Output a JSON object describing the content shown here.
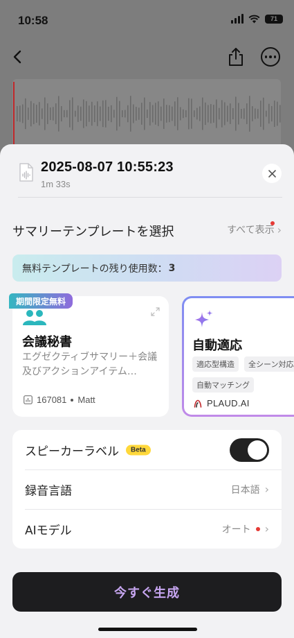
{
  "status_bar": {
    "time": "10:58",
    "battery": "71"
  },
  "recording": {
    "title": "2025-08-07 10:55:23",
    "duration": "1m 33s"
  },
  "template_section": {
    "title": "サマリーテンプレートを選択",
    "show_all": "すべて表示"
  },
  "quota": {
    "label": "無料テンプレートの残り使用数：",
    "count": "3"
  },
  "templates": [
    {
      "badge": "期間限定無料",
      "title": "会議秘書",
      "description": "エグゼクティブサマリー＋会議及びアクションアイテム…",
      "uses": "167081",
      "author": "Matt"
    },
    {
      "title": "自動適応",
      "tags": [
        "適応型構造",
        "全シーン対応",
        "自動マッチング"
      ],
      "brand": "PLAUD.AI"
    }
  ],
  "settings": {
    "speaker_label": "スピーカーラベル",
    "beta": "Beta",
    "speaker_label_enabled": true,
    "language_label": "録音言語",
    "language_value": "日本語",
    "model_label": "AIモデル",
    "model_value": "オート"
  },
  "generate_button": "今すぐ生成",
  "colors": {
    "accent_teal": "#35b6c1",
    "accent_purple": "#8f6bdc",
    "badge_yellow": "#ffd83b",
    "notify_red": "#e53a35"
  }
}
